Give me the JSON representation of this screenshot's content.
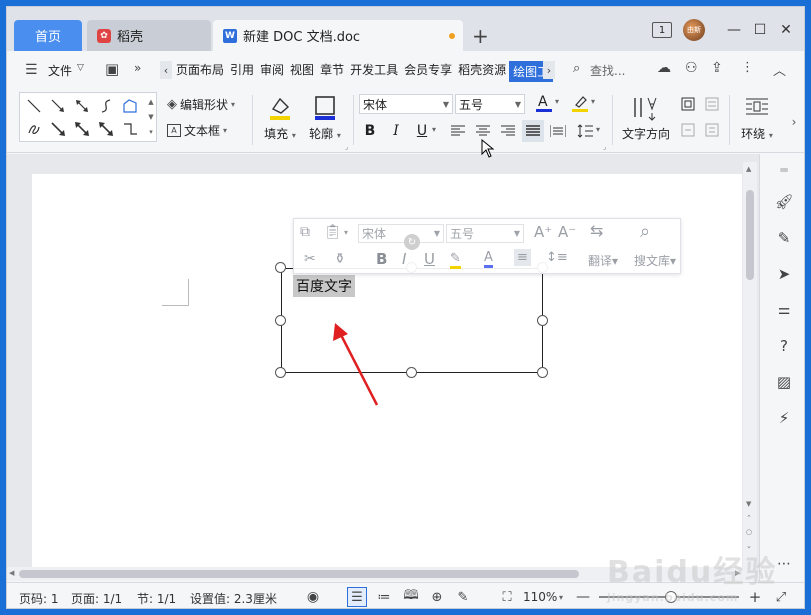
{
  "tabs": {
    "home": "首页",
    "daoke": "稻壳",
    "document": "新建 DOC 文档.doc",
    "new_tab": "+"
  },
  "titlebar": {
    "window_count": "1",
    "avatar_text": "由斯"
  },
  "menu": {
    "file": "文件",
    "items": [
      "页面布局",
      "引用",
      "审阅",
      "视图",
      "章节",
      "开发工具",
      "会员专享",
      "稻壳资源",
      "绘图工"
    ],
    "active_item": "绘图工",
    "search": "查找..."
  },
  "ribbon": {
    "edit_shape": "编辑形状",
    "text_box": "文本框",
    "fill": "填充",
    "outline": "轮廓",
    "font_name": "宋体",
    "font_size": "五号",
    "text_direction": "文字方向",
    "wrap": "环绕"
  },
  "textbox": {
    "text": "百度文字"
  },
  "mini_toolbar": {
    "font_name": "宋体",
    "font_size": "五号",
    "translate": "翻译",
    "search_library": "搜文库"
  },
  "status": {
    "page_code": "页码: 1",
    "pages": "页面: 1/1",
    "section": "节: 1/1",
    "setting": "设置值: 2.3厘米",
    "zoom": "110%"
  },
  "watermark": {
    "text": "Baidu经验",
    "sub": "jingyan.baidu.com"
  },
  "colors": {
    "accent": "#2f6fdb",
    "home_tab": "#4a8ff0",
    "unsaved_dot": "#f0a020",
    "arrow": "#e02020"
  }
}
